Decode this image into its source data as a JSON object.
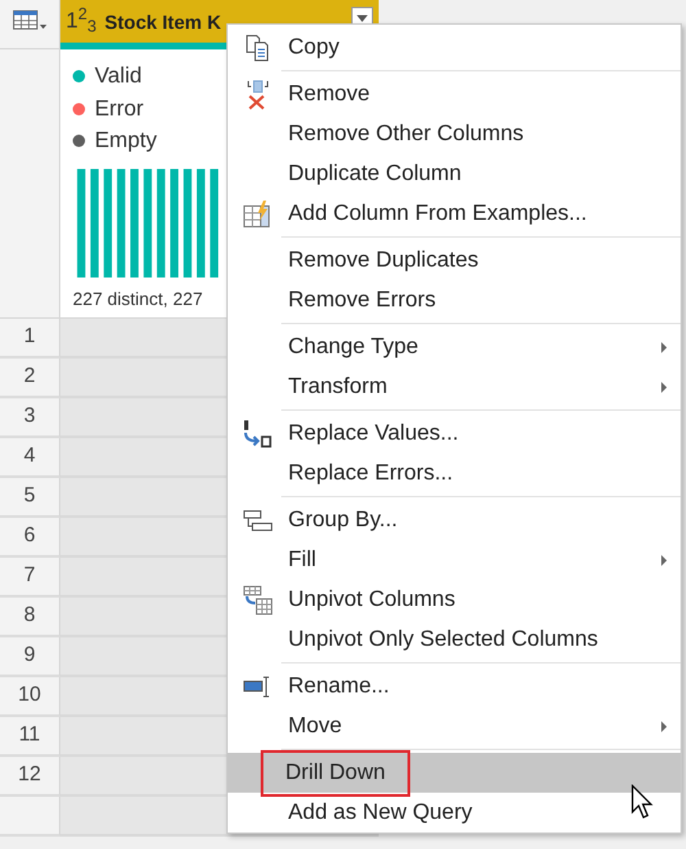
{
  "column_header": {
    "type_label": "1$^{2}$$_{3}$",
    "name": "Stock Item K"
  },
  "profile": {
    "legend": [
      {
        "label": "Valid",
        "color": "#01b8aa"
      },
      {
        "label": "Error",
        "color": "#fd625e"
      },
      {
        "label": "Empty",
        "color": "#5f5f5f"
      }
    ],
    "summary": "227 distinct, 227"
  },
  "row_numbers": [
    "1",
    "2",
    "3",
    "4",
    "5",
    "6",
    "7",
    "8",
    "9",
    "10",
    "11",
    "12"
  ],
  "context_menu": {
    "groups": [
      [
        {
          "label": "Copy",
          "submenu": false,
          "selected": false,
          "outlined": false
        }
      ],
      [
        {
          "label": "Remove",
          "submenu": false,
          "selected": false,
          "outlined": false
        },
        {
          "label": "Remove Other Columns",
          "submenu": false,
          "selected": false,
          "outlined": false
        },
        {
          "label": "Duplicate Column",
          "submenu": false,
          "selected": false,
          "outlined": false
        },
        {
          "label": "Add Column From Examples...",
          "submenu": false,
          "selected": false,
          "outlined": false
        }
      ],
      [
        {
          "label": "Remove Duplicates",
          "submenu": false,
          "selected": false,
          "outlined": false
        },
        {
          "label": "Remove Errors",
          "submenu": false,
          "selected": false,
          "outlined": false
        }
      ],
      [
        {
          "label": "Change Type",
          "submenu": true,
          "selected": false,
          "outlined": false
        },
        {
          "label": "Transform",
          "submenu": true,
          "selected": false,
          "outlined": false
        }
      ],
      [
        {
          "label": "Replace Values...",
          "submenu": false,
          "selected": false,
          "outlined": false
        },
        {
          "label": "Replace Errors...",
          "submenu": false,
          "selected": false,
          "outlined": false
        }
      ],
      [
        {
          "label": "Group By...",
          "submenu": false,
          "selected": false,
          "outlined": false
        },
        {
          "label": "Fill",
          "submenu": true,
          "selected": false,
          "outlined": false
        },
        {
          "label": "Unpivot Columns",
          "submenu": false,
          "selected": false,
          "outlined": false
        },
        {
          "label": "Unpivot Only Selected Columns",
          "submenu": false,
          "selected": false,
          "outlined": false
        }
      ],
      [
        {
          "label": "Rename...",
          "submenu": false,
          "selected": false,
          "outlined": false
        },
        {
          "label": "Move",
          "submenu": true,
          "selected": false,
          "outlined": false
        }
      ],
      [
        {
          "label": "Drill Down",
          "submenu": false,
          "selected": true,
          "outlined": true
        },
        {
          "label": "Add as New Query",
          "submenu": false,
          "selected": false,
          "outlined": false
        }
      ]
    ]
  }
}
